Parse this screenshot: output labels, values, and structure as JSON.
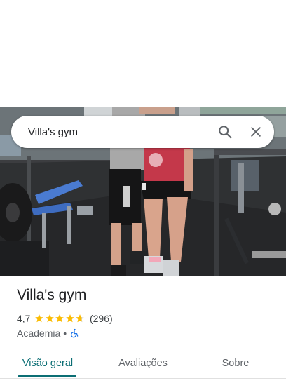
{
  "search": {
    "query": "Villa's gym",
    "search_icon": "search-icon",
    "close_icon": "close-icon"
  },
  "photo": {
    "description_icon": "gym-photo"
  },
  "place": {
    "name": "Villa's gym",
    "rating": "4,7",
    "rating_value": 4.7,
    "review_count": "(296)",
    "category": "Academia",
    "separator": "•",
    "accessibility_icon": "wheelchair-accessible-icon"
  },
  "tabs": [
    {
      "label": "Visão geral",
      "active": true
    },
    {
      "label": "Avaliações",
      "active": false
    },
    {
      "label": "Sobre",
      "active": false
    }
  ],
  "colors": {
    "accent": "#0b6e74",
    "star": "#fbbc04",
    "accessibility": "#1a73e8"
  }
}
